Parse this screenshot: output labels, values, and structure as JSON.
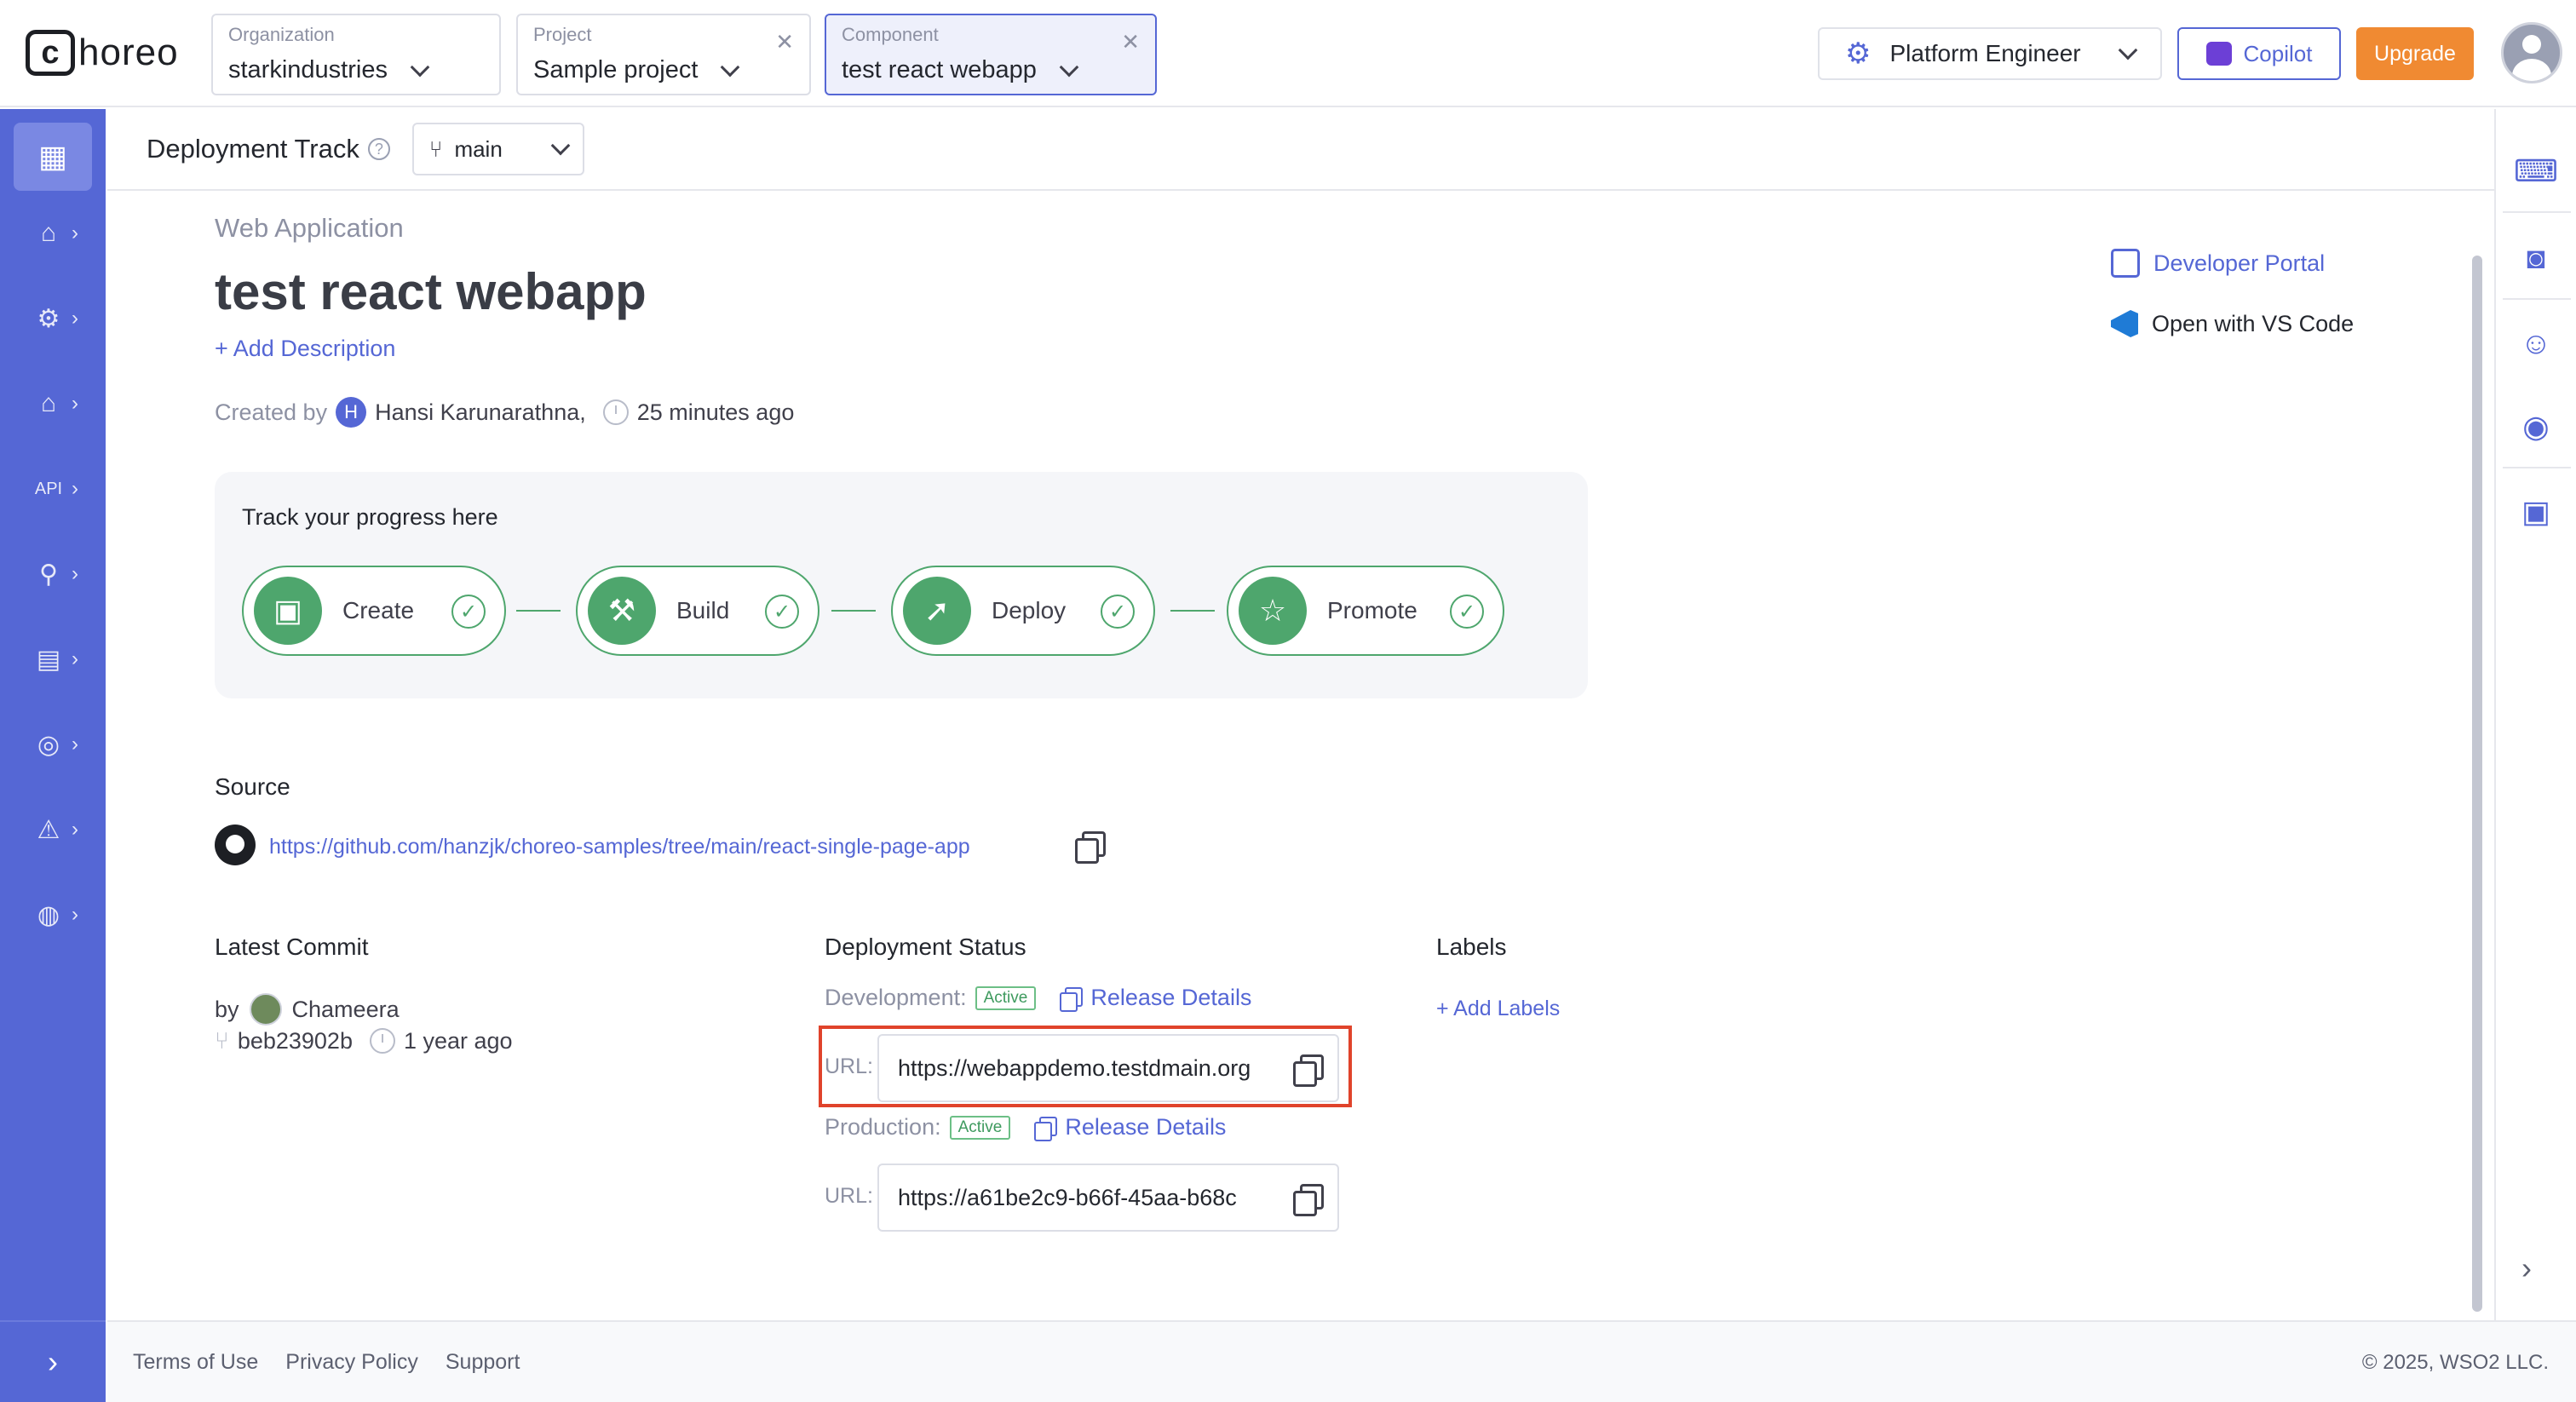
{
  "brand": {
    "mark": "c",
    "name": "horeo"
  },
  "header": {
    "organization": {
      "label": "Organization",
      "value": "starkindustries"
    },
    "project": {
      "label": "Project",
      "value": "Sample project"
    },
    "component": {
      "label": "Component",
      "value": "test react webapp"
    },
    "role": "Platform Engineer",
    "copilot": "Copilot",
    "upgrade": "Upgrade"
  },
  "subheader": {
    "title": "Deployment Track",
    "branch": "main"
  },
  "component": {
    "kind": "Web Application",
    "name": "test react webapp",
    "add_description": "Add Description",
    "created_by_label": "Created by",
    "author_initial": "H",
    "author": "Hansi Karunarathna,",
    "created_ago": "25 minutes ago"
  },
  "progress": {
    "title": "Track your progress here",
    "steps": [
      {
        "label": "Create",
        "icon": "create-icon"
      },
      {
        "label": "Build",
        "icon": "build-icon"
      },
      {
        "label": "Deploy",
        "icon": "rocket-icon"
      },
      {
        "label": "Promote",
        "icon": "star-icon"
      }
    ]
  },
  "source": {
    "title": "Source",
    "url": "https://github.com/hanzjk/choreo-samples/tree/main/react-single-page-app"
  },
  "commit": {
    "title": "Latest Commit",
    "by_label": "by",
    "author": "Chameera",
    "hash": "beb23902b",
    "ago": "1 year ago"
  },
  "deployment": {
    "title": "Deployment Status",
    "environments": [
      {
        "name": "Development:",
        "status": "Active",
        "release_link": "Release Details",
        "url_label": "URL:",
        "url": "https://webappdemo.testdmain.org"
      },
      {
        "name": "Production:",
        "status": "Active",
        "release_link": "Release Details",
        "url_label": "URL:",
        "url": "https://a61be2c9-b66f-45aa-b68c"
      }
    ]
  },
  "labels": {
    "title": "Labels",
    "add": "Add Labels"
  },
  "quick_links": {
    "developer_portal": "Developer Portal",
    "vscode": "Open with VS Code"
  },
  "footer": {
    "links": [
      "Terms of Use",
      "Privacy Policy",
      "Support"
    ],
    "copyright": "© 2025, WSO2 LLC."
  },
  "colors": {
    "primary": "#5567d5",
    "success": "#4ea66d",
    "upgrade": "#f08a32",
    "highlight": "#e0432b"
  }
}
